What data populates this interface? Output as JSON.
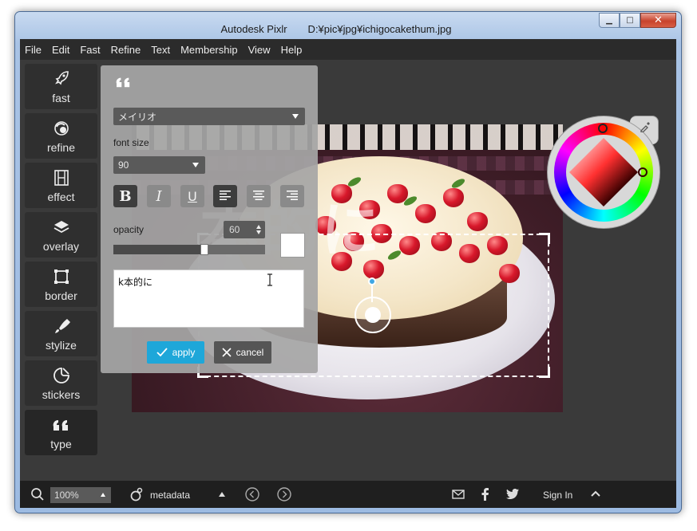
{
  "window": {
    "title": "Autodesk Pixlr　　D:¥pic¥jpg¥ichigocakethum.jpg",
    "minimize": "▁",
    "maximize": "□",
    "close": "✕"
  },
  "menu": [
    "File",
    "Edit",
    "Fast",
    "Refine",
    "Text",
    "Membership",
    "View",
    "Help"
  ],
  "tools": [
    {
      "label": "fast",
      "icon": "rocket-icon"
    },
    {
      "label": "refine",
      "icon": "refine-icon"
    },
    {
      "label": "effect",
      "icon": "film-icon"
    },
    {
      "label": "overlay",
      "icon": "layers-icon"
    },
    {
      "label": "border",
      "icon": "border-frame-icon"
    },
    {
      "label": "stylize",
      "icon": "brush-icon"
    },
    {
      "label": "stickers",
      "icon": "sticker-icon"
    },
    {
      "label": "type",
      "icon": "quote-icon",
      "active": true
    }
  ],
  "type_panel": {
    "font": "メイリオ",
    "font_size_label": "font size",
    "font_size": "90",
    "opacity_label": "opacity",
    "opacity": "60",
    "opacity_fraction": 0.6,
    "color": "#ffffff",
    "text": "k本的に",
    "apply": "apply",
    "cancel": "cancel",
    "format_buttons": [
      {
        "name": "bold-button",
        "glyph": "B",
        "active": true
      },
      {
        "name": "italic-button",
        "glyph": "I",
        "active": false
      },
      {
        "name": "underline-button",
        "glyph": "U",
        "active": false
      },
      {
        "name": "align-left-button",
        "glyph": "",
        "active": true
      },
      {
        "name": "align-center-button",
        "glyph": "",
        "active": false
      },
      {
        "name": "align-right-button",
        "glyph": "",
        "active": false
      }
    ]
  },
  "canvas": {
    "overlay_text": "本的に"
  },
  "statusbar": {
    "zoom": "100%",
    "metadata": "metadata",
    "sign_in": "Sign In"
  },
  "colors": {
    "accent": "#1ea7d9",
    "panel": "#a6a6a6",
    "dark": "#2b2b2b"
  }
}
